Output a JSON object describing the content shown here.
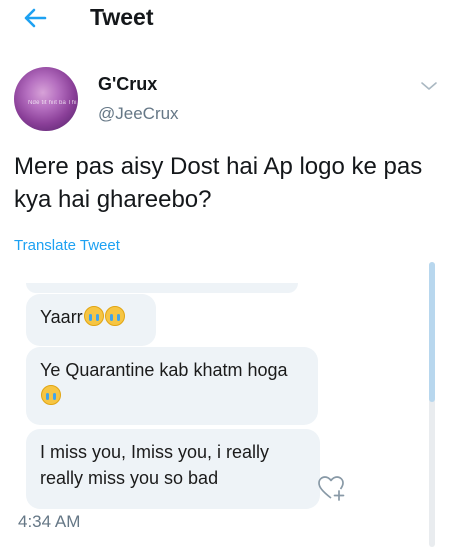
{
  "header": {
    "title": "Tweet"
  },
  "author": {
    "display_name": "G'Crux",
    "handle": "@JeeCrux",
    "avatar_overlay_text": "Nde tit hiit ba Thi"
  },
  "tweet": {
    "text": "Mere pas aisy Dost hai Ap logo ke pas kya hai ghareebo?",
    "translate_label": "Translate Tweet",
    "timestamp": "4:34 AM"
  },
  "media": {
    "messages": [
      {
        "text": "Yaarr",
        "emoji_count": 2
      },
      {
        "text": "Ye Quarantine kab khatm hoga",
        "emoji_count": 1
      },
      {
        "text": "I miss you, Imiss you, i really really miss you so bad",
        "emoji_count": 0
      }
    ]
  },
  "colors": {
    "accent": "#1da1f2",
    "secondary_text": "#657786",
    "bubble": "#eef3f7"
  },
  "icons": [
    "back-arrow-icon",
    "chevron-down-icon",
    "heart-plus-icon",
    "crying-face-emoji"
  ]
}
